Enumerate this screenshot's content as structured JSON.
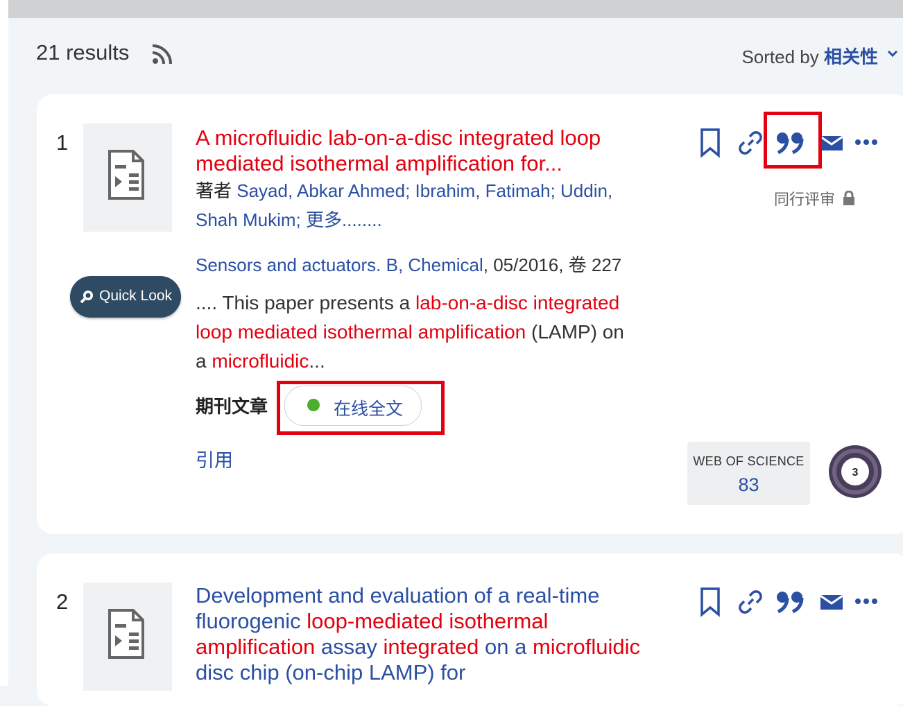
{
  "header": {
    "results_count": "21 results",
    "sort_label": "Sorted by",
    "sort_value": "相关性"
  },
  "results": [
    {
      "number": "1",
      "title_parts": [
        "A microfluidic lab-on-a-disc integrated loop mediated isothermal amplification for..."
      ],
      "authors_label": "著者",
      "authors": "Sayad, Abkar Ahmed; Ibrahim, Fatimah; Uddin, Shah Mukim",
      "authors_more": "; 更多........",
      "source_journal": "Sensors and actuators. B, Chemical",
      "source_meta": ", 05/2016, 卷 227",
      "snippet_parts": [
        ".... This paper presents a ",
        "lab-on-a-disc integrated loop mediated isothermal amplification",
        " (LAMP) on a ",
        "microfluidic",
        "..."
      ],
      "quick_look": "Quick Look",
      "doc_type": "期刊文章",
      "fulltext_label": "在线全文",
      "cite_link": "引用",
      "peer_review": "同行评审",
      "wos_label": "WEB OF SCIENCE",
      "wos_count": "83",
      "altmetric_score": "3"
    },
    {
      "number": "2",
      "title_parts": [
        "Development and evaluation of a real-time fluorogenic ",
        "loop-mediated isothermal amplification",
        " assay ",
        "integrated",
        " on a ",
        "microfluidic",
        " disc chip (on-chip LAMP) for"
      ]
    }
  ],
  "colors": {
    "link_blue": "#2a4fa3",
    "highlight_red": "#e3000f",
    "fulltext_green": "#4caf2c",
    "quicklook_bg": "#2f4a63"
  },
  "icons": [
    "rss-icon",
    "chevron-down-icon",
    "document-icon",
    "bookmark-icon",
    "link-icon",
    "quote-icon",
    "email-icon",
    "more-icon",
    "magnifier-icon",
    "lock-icon"
  ]
}
